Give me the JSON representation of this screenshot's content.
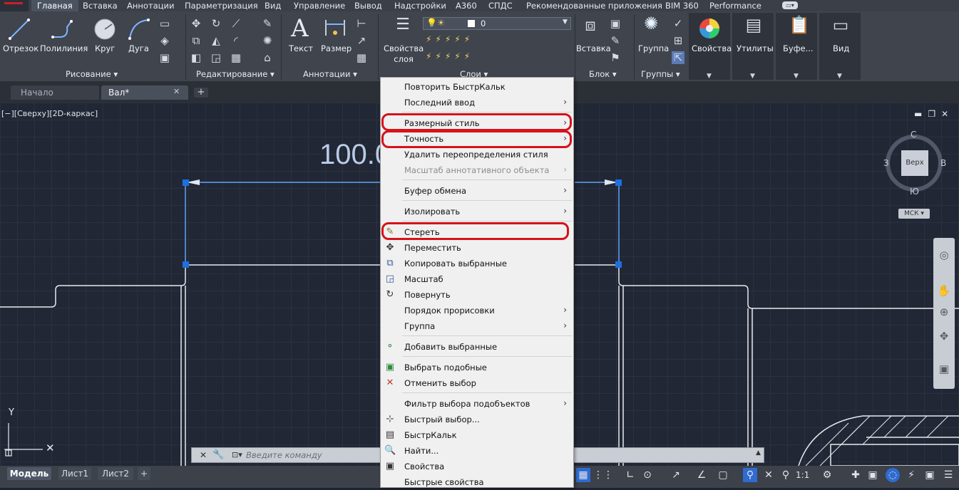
{
  "ribbon_tabs": [
    "Главная",
    "Вставка",
    "Аннотации",
    "Параметризация",
    "Вид",
    "Управление",
    "Вывод",
    "Надстройки",
    "A360",
    "СПДС",
    "Рекомендованные приложения",
    "BIM 360",
    "Performance"
  ],
  "ribbon": {
    "draw": {
      "title": "Рисование ▾",
      "line": "Отрезок",
      "polyline": "Полилиния",
      "circle": "Круг",
      "arc": "Дуга"
    },
    "modify": {
      "title": "Редактирование ▾"
    },
    "annotation": {
      "title": "Аннотации ▾",
      "text": "Текст",
      "dimension": "Размер"
    },
    "layers": {
      "title": "Слои ▾",
      "properties_label": "Свойства\nслоя",
      "current_layer": "0"
    },
    "block": {
      "title": "Блок ▾",
      "insert": "Вставка"
    },
    "groups": {
      "title": "Группы ▾",
      "group": "Группа"
    },
    "properties": {
      "label": "Свойства"
    },
    "utilities": {
      "label": "Утилиты"
    },
    "clipboard": {
      "label": "Буфе..."
    },
    "view": {
      "label": "Вид"
    }
  },
  "doc_tabs": {
    "home": "Начало",
    "active": "Вал*"
  },
  "viewport": {
    "label": "[−][Сверху][2D-каркас]",
    "dimension_text": "100.0",
    "viewcube": {
      "face": "Верх",
      "north": "С",
      "south": "Ю",
      "west": "З",
      "east": "В",
      "wcs": "МСК ▾"
    }
  },
  "command_line": {
    "placeholder": "Введите команду"
  },
  "ucs": {
    "y": "Y"
  },
  "layout_tabs": [
    "Модель",
    "Лист1",
    "Лист2"
  ],
  "status": {
    "scale": "1:1"
  },
  "context_menu": [
    {
      "label": "Повторить БыстрКальк",
      "submenu": false,
      "icon": ""
    },
    {
      "label": "Последний ввод",
      "submenu": true,
      "icon": ""
    },
    {
      "label": "Размерный стиль",
      "submenu": true,
      "icon": "",
      "highlighted": true
    },
    {
      "label": "Точность",
      "submenu": true,
      "icon": "",
      "highlighted": true
    },
    {
      "label": "Удалить переопределения стиля",
      "submenu": false,
      "icon": ""
    },
    {
      "label": "Масштаб аннотативного объекта",
      "submenu": true,
      "icon": "",
      "disabled": true
    },
    {
      "label": "Буфер обмена",
      "submenu": true,
      "icon": ""
    },
    {
      "label": "Изолировать",
      "submenu": true,
      "icon": ""
    },
    {
      "label": "Стереть",
      "submenu": false,
      "icon": "erase-icon",
      "highlighted": true
    },
    {
      "label": "Переместить",
      "submenu": false,
      "icon": "move-icon"
    },
    {
      "label": "Копировать выбранные",
      "submenu": false,
      "icon": "copy-icon"
    },
    {
      "label": "Масштаб",
      "submenu": false,
      "icon": "scale-icon"
    },
    {
      "label": "Повернуть",
      "submenu": false,
      "icon": "rotate-icon"
    },
    {
      "label": "Порядок прорисовки",
      "submenu": true,
      "icon": ""
    },
    {
      "label": "Группа",
      "submenu": true,
      "icon": ""
    },
    {
      "label": "Добавить выбранные",
      "submenu": false,
      "icon": "add-selected-icon"
    },
    {
      "label": "Выбрать подобные",
      "submenu": false,
      "icon": "select-similar-icon"
    },
    {
      "label": "Отменить выбор",
      "submenu": false,
      "icon": "deselect-icon"
    },
    {
      "label": "Фильтр выбора подобъектов",
      "submenu": true,
      "icon": ""
    },
    {
      "label": "Быстрый выбор...",
      "submenu": false,
      "icon": "quick-select-icon"
    },
    {
      "label": "БыстрКальк",
      "submenu": false,
      "icon": "calculator-icon"
    },
    {
      "label": "Найти...",
      "submenu": false,
      "icon": "find-icon"
    },
    {
      "label": "Свойства",
      "submenu": false,
      "icon": "properties-icon"
    },
    {
      "label": "Быстрые свойства",
      "submenu": false,
      "icon": ""
    }
  ],
  "colors": {
    "highlight": "#d6121b",
    "selection": "#1e6fe0",
    "canvas": "#212734"
  }
}
